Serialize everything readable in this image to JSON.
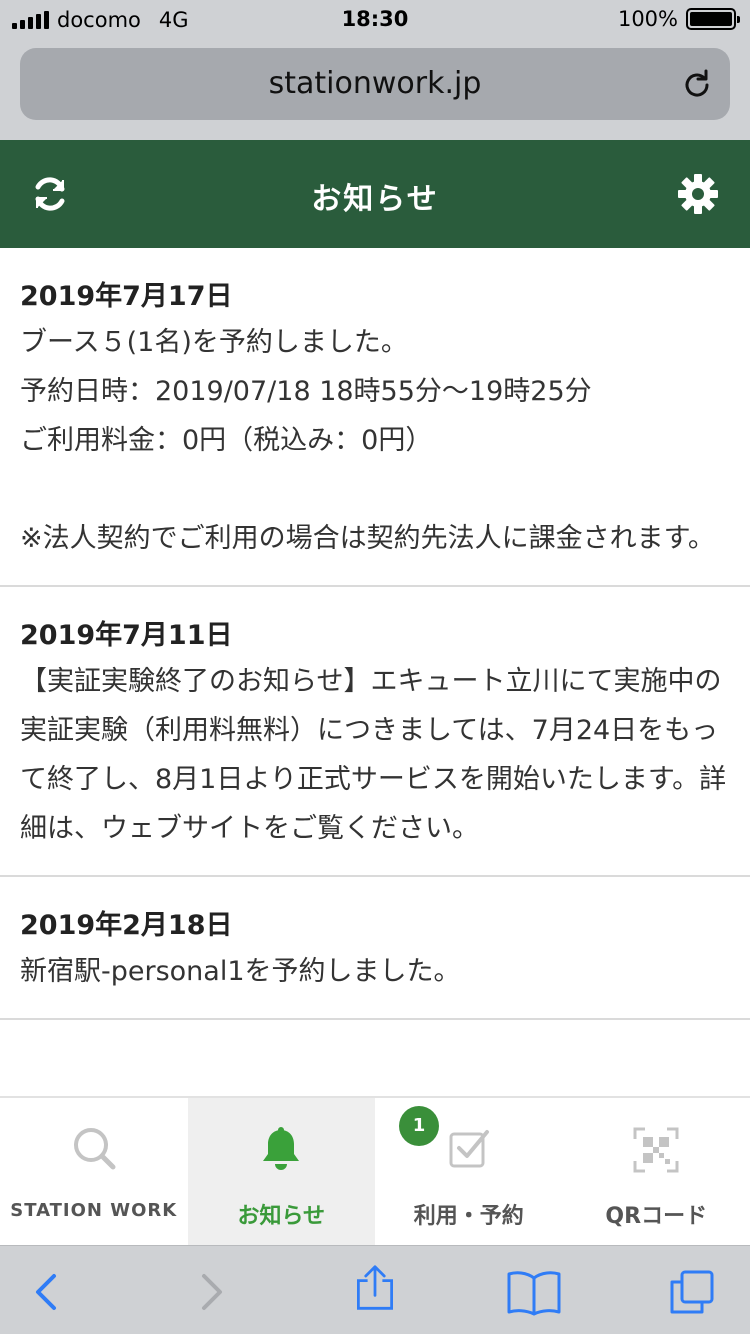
{
  "status": {
    "carrier": "docomo",
    "network": "4G",
    "time": "18:30",
    "battery": "100%"
  },
  "browser": {
    "url": "stationwork.jp"
  },
  "header": {
    "title": "お知らせ"
  },
  "notices": [
    {
      "date": "2019年7月17日",
      "body": "ブース５(1名)を予約しました。\n予約日時：2019/07/18 18時55分〜19時25分\nご利用料金：0円（税込み：0円）\n\n※法人契約でご利用の場合は契約先法人に課金されます。"
    },
    {
      "date": "2019年7月11日",
      "body": "【実証実験終了のお知らせ】エキュート立川にて実施中の実証実験（利用料無料）につきましては、7月24日をもって終了し、8月1日より正式サービスを開始いたします。詳細は、ウェブサイトをご覧ください。"
    },
    {
      "date": "2019年2月18日",
      "body": "新宿駅-personal1を予約しました。"
    }
  ],
  "tabs": [
    {
      "label": "STATION WORK",
      "icon": "search-icon"
    },
    {
      "label": "お知らせ",
      "icon": "bell-icon",
      "active": true
    },
    {
      "label": "利用・予約",
      "icon": "checkbox-icon",
      "badge": "1"
    },
    {
      "label": "QRコード",
      "icon": "qr-code-icon"
    }
  ],
  "colors": {
    "header": "#2a5c3c",
    "accent": "#3a9a3a",
    "badge": "#3a8f3a"
  }
}
